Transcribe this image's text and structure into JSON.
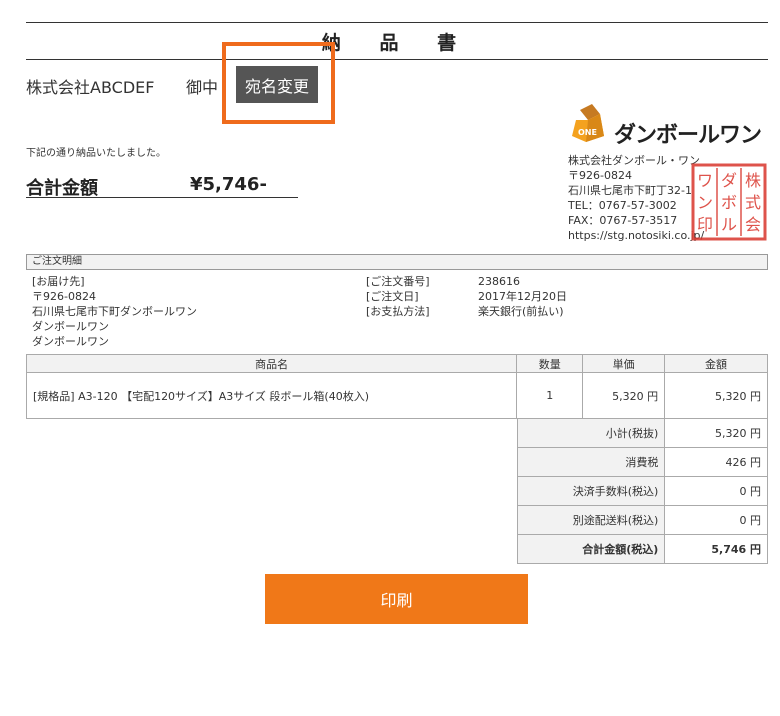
{
  "document": {
    "title": "納 品 書",
    "addressee": "株式会社ABCDEF",
    "honorific": "御中",
    "rename_button": "宛名変更",
    "intro": "下記の通り納品いたしました。",
    "total_label": "合計金額",
    "total_value": "¥5,746-"
  },
  "company": {
    "logo_text": "ダンボールワン",
    "logo_badge": "ONE",
    "name": "株式会社ダンボール・ワン",
    "postal": "〒926-0824",
    "address": "石川県七尾市下町丁32-1",
    "tel": "TEL：0767-57-3002",
    "fax": "FAX：0767-57-3517",
    "url": "https://stg.notosiki.co.jp/",
    "seal_text": "株式会社ダンボール・ワン印"
  },
  "order": {
    "section_title": "ご注文明細",
    "delivery_label": "[お届け先]",
    "delivery_postal": "〒926-0824",
    "delivery_address": "石川県七尾市下町ダンボールワン",
    "delivery_line2": "ダンボールワン",
    "delivery_line3": "ダンボールワン",
    "order_no_label": "[ご注文番号]",
    "order_date_label": "[ご注文日]",
    "payment_label": "[お支払方法]",
    "order_no": "238616",
    "order_date": "2017年12月20日",
    "payment": "楽天銀行(前払い)"
  },
  "items": {
    "headers": {
      "name": "商品名",
      "qty": "数量",
      "unit": "単価",
      "amount": "金額"
    },
    "rows": [
      {
        "name": "[規格品] A3-120 【宅配120サイズ】A3サイズ 段ボール箱(40枚入)",
        "qty": "1",
        "unit": "5,320 円",
        "amount": "5,320 円"
      }
    ]
  },
  "summary": {
    "subtotal_label": "小計(税抜)",
    "subtotal": "5,320 円",
    "tax_label": "消費税",
    "tax": "426 円",
    "fee_label": "決済手数料(税込)",
    "fee": "0 円",
    "shipping_label": "別途配送料(税込)",
    "shipping": "0 円",
    "grand_label": "合計金額(税込)",
    "grand": "5,746 円"
  },
  "actions": {
    "print_label": "印刷"
  },
  "colors": {
    "accent_orange": "#f07818",
    "highlight_orange": "#ef6b1c",
    "seal_red": "#d9362c",
    "button_gray": "#555555"
  }
}
